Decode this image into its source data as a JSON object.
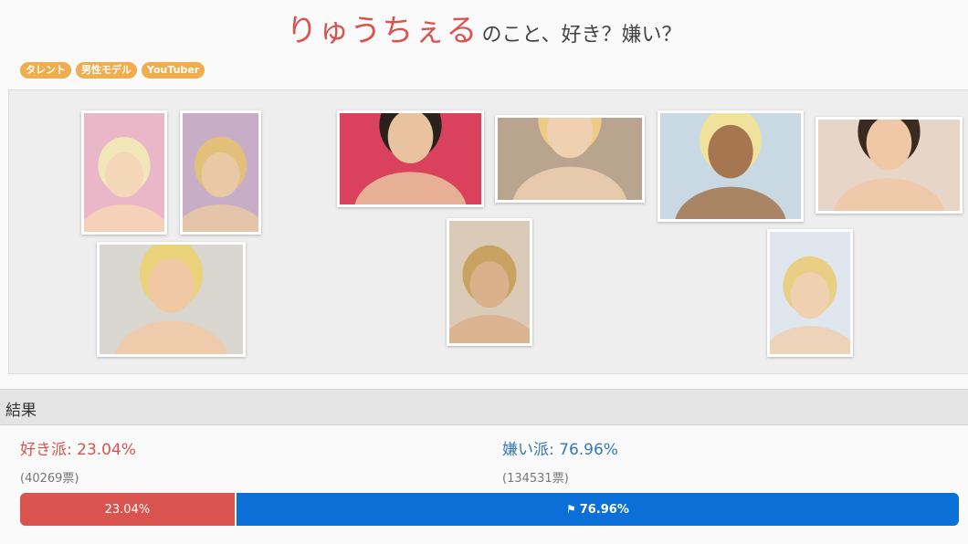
{
  "header": {
    "name": "りゅうちぇる",
    "question": "のこと、好き？嫌い？"
  },
  "tags": [
    "タレント",
    "男性モデル",
    "YouTuber"
  ],
  "photos": [
    {
      "bg": "#e9b7c8",
      "fg": "#f4d7b6",
      "hair": "#f1e6b8"
    },
    {
      "bg": "#c7aec6",
      "fg": "#e9c9a5",
      "hair": "#e2c079"
    },
    {
      "bg": "#d9d5cf",
      "fg": "#f0c9a4",
      "hair": "#ead27a"
    },
    {
      "bg": "#d9415d",
      "fg": "#e9c3a0",
      "hair": "#2a211c"
    },
    {
      "bg": "#b9a58f",
      "fg": "#efd0b0",
      "hair": "#efc986"
    },
    {
      "bg": "#d9cbb7",
      "fg": "#d9b08a",
      "hair": "#c9a161"
    },
    {
      "bg": "#c9d9e4",
      "fg": "#a5764f",
      "hair": "#f1e29b"
    },
    {
      "bg": "#e7d6c7",
      "fg": "#f0c8a5",
      "hair": "#3a2a20"
    },
    {
      "bg": "#dfe6ee",
      "fg": "#efd0b0",
      "hair": "#e8cf84"
    }
  ],
  "results": {
    "section_title": "結果",
    "like_label": "好き派:",
    "like_pct_text": "23.04%",
    "like_votes": "(40269票)",
    "hate_label": "嫌い派:",
    "hate_pct_text": "76.96%",
    "hate_votes": "(134531票)",
    "like_fraction": 0.2304,
    "bar_like_text": "23.04%",
    "bar_hate_text": "76.96%"
  },
  "colors": {
    "like": "#d9534f",
    "hate": "#0a6fd6",
    "tag": "#f0ad4e"
  }
}
